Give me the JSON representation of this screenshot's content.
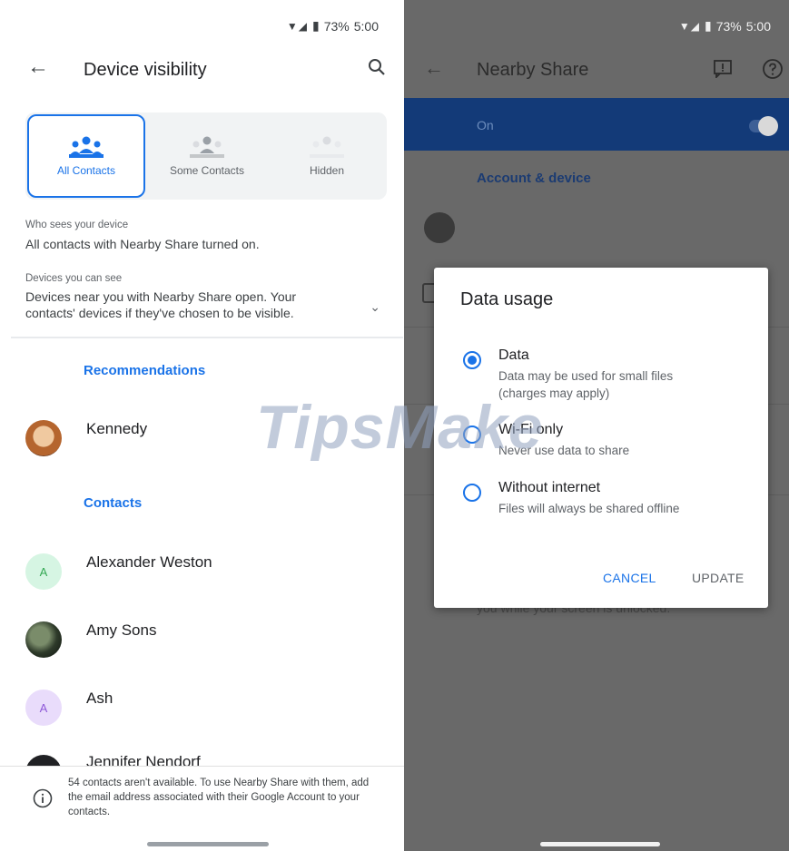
{
  "left": {
    "status": {
      "battery": "73%",
      "time": "5:00"
    },
    "title": "Device visibility",
    "visibility_options": [
      {
        "label": "All Contacts",
        "selected": true
      },
      {
        "label": "Some Contacts",
        "selected": false
      },
      {
        "label": "Hidden",
        "selected": false
      }
    ],
    "who_sees_label": "Who sees your device",
    "who_sees_value": "All contacts with Nearby Share turned on.",
    "devices_label": "Devices you can see",
    "devices_value_1": "Devices near you with Nearby Share open. Your",
    "devices_value_2": "contacts' devices if they've chosen to be visible.",
    "recommendations_heading": "Recommendations",
    "recommendations": [
      {
        "name": "Kennedy"
      }
    ],
    "contacts_heading": "Contacts",
    "contacts": [
      {
        "name": "Alexander Weston",
        "initial": "A"
      },
      {
        "name": "Amy Sons",
        "initial": ""
      },
      {
        "name": "Ash",
        "initial": "A"
      },
      {
        "name": "Jennifer Nendorf",
        "initial": ""
      }
    ],
    "notice": "54 contacts aren't available. To use Nearby Share with them, add the email address associated with their Google Account to your contacts."
  },
  "right": {
    "status": {
      "battery": "73%",
      "time": "5:00"
    },
    "title": "Nearby Share",
    "on_label": "On",
    "toggle_on": true,
    "account_heading": "Account & device",
    "bg_text": "you while your screen is unlocked.",
    "dialog": {
      "title": "Data usage",
      "options": [
        {
          "label": "Data",
          "desc_1": "Data may be used for small files",
          "desc_2": "(charges may apply)",
          "selected": true
        },
        {
          "label": "Wi-Fi only",
          "desc_1": "Never use data to share",
          "selected": false
        },
        {
          "label": "Without internet",
          "desc_1": "Files will always be shared offline",
          "selected": false
        }
      ],
      "cancel": "CANCEL",
      "update": "UPDATE"
    }
  },
  "watermark": "TipsMake",
  "colors": {
    "accent": "#1a73e8",
    "on_bar": "#133a78",
    "scrim": "#696969"
  }
}
